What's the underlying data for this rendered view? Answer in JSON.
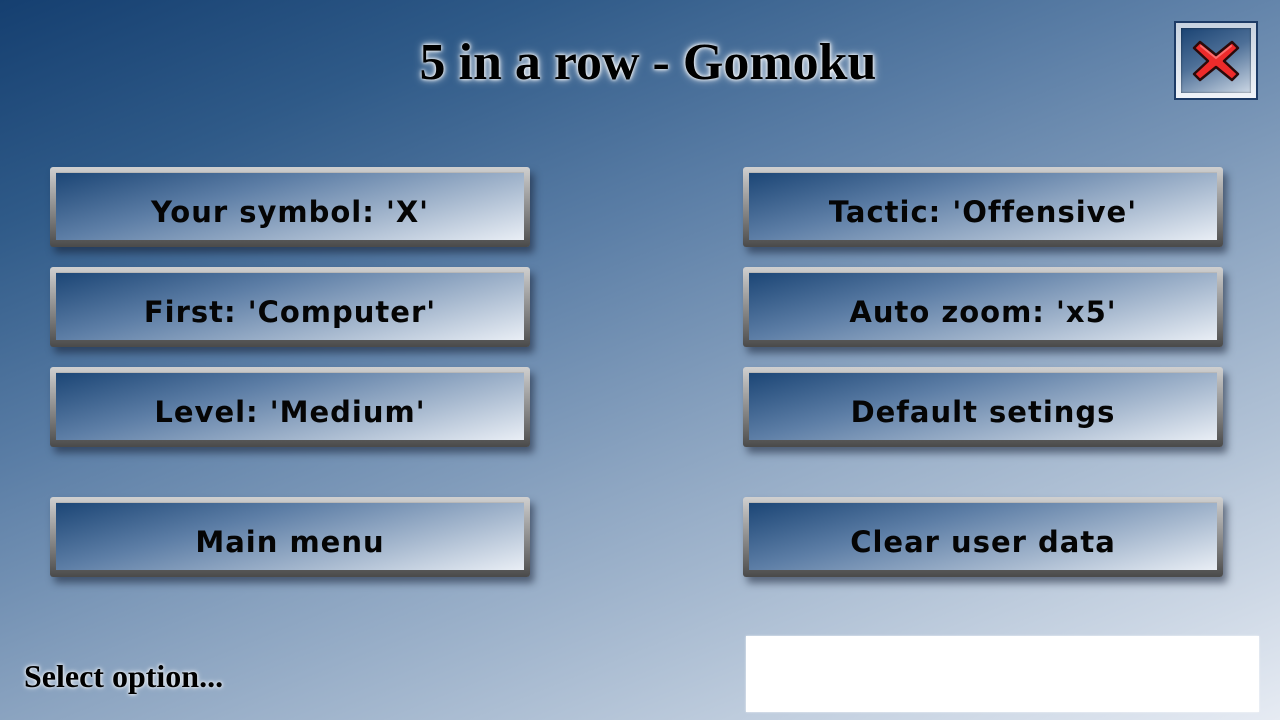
{
  "header": {
    "title": "5 in a row - Gomoku",
    "close_icon": "close-x-icon"
  },
  "options": {
    "left": [
      {
        "id": "your-symbol",
        "label": "Your symbol: 'X'"
      },
      {
        "id": "first",
        "label": "First: 'Computer'"
      },
      {
        "id": "level",
        "label": "Level: 'Medium'"
      },
      {
        "id": "main-menu",
        "label": "Main menu"
      }
    ],
    "right": [
      {
        "id": "tactic",
        "label": "Tactic: 'Offensive'"
      },
      {
        "id": "auto-zoom",
        "label": "Auto zoom: 'x5'"
      },
      {
        "id": "default-settings",
        "label": "Default setings"
      },
      {
        "id": "clear-user-data",
        "label": "Clear user data"
      }
    ]
  },
  "status": {
    "text": "Select option...",
    "box_text": ""
  },
  "colors": {
    "close_x": "#ee2b2b",
    "bg_dark": "#153f70",
    "bg_light": "#e6ebf3"
  }
}
